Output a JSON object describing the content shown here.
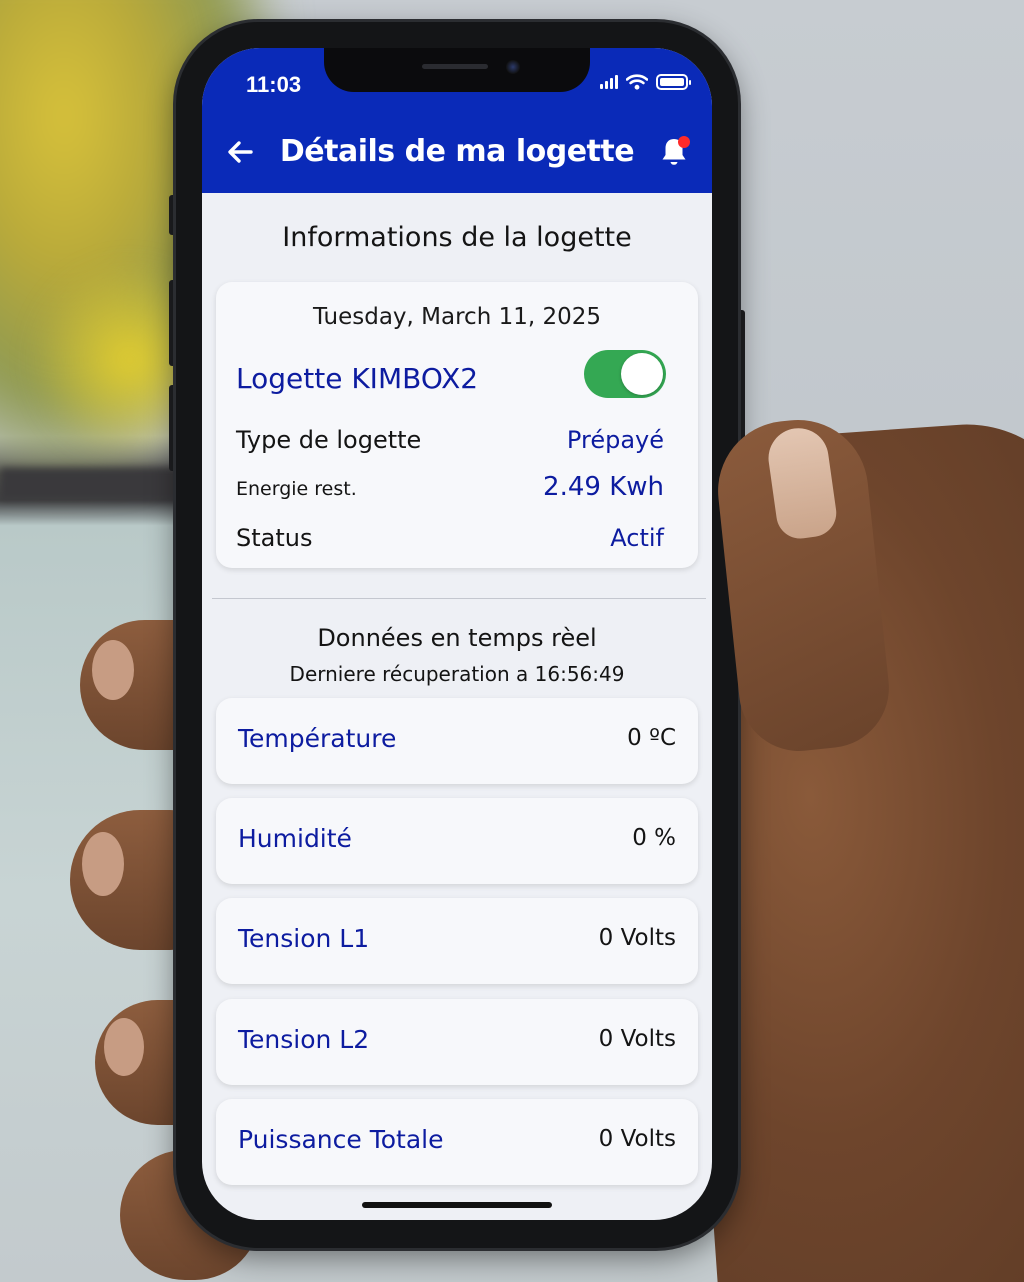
{
  "status_bar": {
    "time": "11:03"
  },
  "header": {
    "title": "Détails de ma logette",
    "back_icon": "arrow-left-icon",
    "notification_icon": "bell-icon"
  },
  "info_section": {
    "title": "Informations de la logette",
    "date": "Tuesday, March 11, 2025",
    "logette_name": "Logette KIMBOX2",
    "toggle_on": true,
    "rows": [
      {
        "label": "Type de logette",
        "value": "Prépayé"
      },
      {
        "label": "Energie rest.",
        "value": "2.49 Kwh"
      },
      {
        "label": "Status",
        "value": "Actif"
      }
    ]
  },
  "realtime_section": {
    "title": "Données en temps rèel",
    "subtitle": "Derniere récuperation a 16:56:49",
    "metrics": [
      {
        "label": "Température",
        "value": "0 ºC"
      },
      {
        "label": "Humidité",
        "value": "0 %"
      },
      {
        "label": "Tension L1",
        "value": "0 Volts"
      },
      {
        "label": "Tension L2",
        "value": "0 Volts"
      },
      {
        "label": "Puissance Totale",
        "value": "0 Volts"
      }
    ]
  },
  "colors": {
    "header_bg": "#0a2ab8",
    "accent_text": "#0d1ca0",
    "toggle_on": "#34a853",
    "notification_dot": "#ff2a2a"
  }
}
